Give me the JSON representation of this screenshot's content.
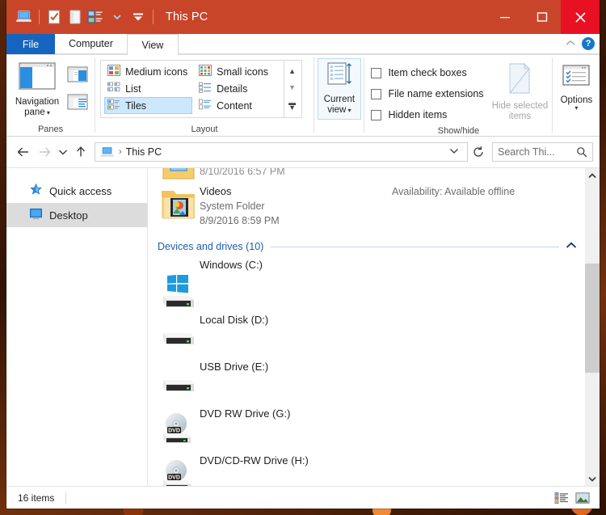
{
  "titlebar": {
    "title": "This PC",
    "quick_access_icons": [
      "this-pc-icon",
      "properties-icon",
      "new-folder-icon",
      "view-icon",
      "customize-dropdown-icon"
    ],
    "window_buttons": [
      {
        "name": "minimize",
        "glyph": "minimize-icon"
      },
      {
        "name": "maximize",
        "glyph": "maximize-icon"
      },
      {
        "name": "close",
        "glyph": "close-icon"
      }
    ],
    "accent_color": "#c9452a",
    "close_color": "#e81123"
  },
  "tabs": {
    "file": "File",
    "items": [
      {
        "label": "Computer",
        "active": false
      },
      {
        "label": "View",
        "active": true
      }
    ],
    "collapse_icon": "chevron-up-icon",
    "help_label": "?"
  },
  "ribbon": {
    "panes": {
      "group_label": "Panes",
      "navigation_pane": "Navigation\npane",
      "navigation_pane_line1": "Navigation",
      "navigation_pane_line2": "pane",
      "preview_pane_icon": "preview-pane-icon",
      "details_pane_icon": "details-pane-icon"
    },
    "layout": {
      "group_label": "Layout",
      "items": [
        {
          "label": "Medium icons",
          "selected": false
        },
        {
          "label": "Small icons",
          "selected": false
        },
        {
          "label": "List",
          "selected": false
        },
        {
          "label": "Details",
          "selected": false
        },
        {
          "label": "Tiles",
          "selected": true
        },
        {
          "label": "Content",
          "selected": false
        }
      ],
      "scroll_up_icon": "scroll-up-icon",
      "scroll_down_icon": "scroll-down-icon",
      "more_icon": "more-layouts-icon"
    },
    "current_view": {
      "group_label": "",
      "line1": "Current",
      "line2": "view",
      "selected": true
    },
    "show_hide": {
      "group_label": "Show/hide",
      "checkboxes": [
        {
          "label": "Item check boxes",
          "checked": false
        },
        {
          "label": "File name extensions",
          "checked": false
        },
        {
          "label": "Hidden items",
          "checked": false
        }
      ],
      "hide_selected_line1": "Hide selected",
      "hide_selected_line2": "items",
      "hide_selected_disabled": true
    },
    "options": {
      "label": "Options"
    }
  },
  "addressbar": {
    "back_icon": "back-arrow-icon",
    "forward_icon": "forward-arrow-icon",
    "recent_icon": "recent-locations-icon",
    "up_icon": "up-arrow-icon",
    "breadcrumb_icon": "this-pc-icon",
    "breadcrumb": "This PC",
    "breadcrumb_separator": "›",
    "dropdown_icon": "chevron-down-icon",
    "refresh_icon": "refresh-icon",
    "search_text": "Search Thi...",
    "search_placeholder": "Search This PC",
    "search_icon": "search-icon"
  },
  "navpane": {
    "items": [
      {
        "label": "Quick access",
        "icon": "star-icon",
        "selected": false
      },
      {
        "label": "Desktop",
        "icon": "desktop-icon",
        "selected": true
      }
    ]
  },
  "filelist": {
    "partial_top_row": {
      "date": "8/10/2016 6:57 PM",
      "icon": "folder-icon"
    },
    "folders": [
      {
        "name": "Videos",
        "type": "System Folder",
        "date": "8/9/2016 8:59 PM",
        "availability": "Availability: Available offline",
        "icon": "videos-folder-icon"
      }
    ],
    "group_header": {
      "label": "Devices and drives (10)",
      "collapse_icon": "chevron-up-icon"
    },
    "drives": [
      {
        "name": "Windows (C:)",
        "icon": "windows-drive-icon"
      },
      {
        "name": "Local Disk (D:)",
        "icon": "hard-drive-icon"
      },
      {
        "name": "USB Drive (E:)",
        "icon": "hard-drive-icon"
      },
      {
        "name": "DVD RW Drive (G:)",
        "icon": "dvd-drive-icon"
      },
      {
        "name": "DVD/CD-RW Drive (H:)",
        "icon": "dvd-drive-icon"
      }
    ],
    "scrollbar": {
      "up_icon": "scroll-up-icon",
      "down_icon": "scroll-down-icon"
    }
  },
  "statusbar": {
    "item_count": "16 items",
    "details_view_icon": "details-view-icon",
    "large_icons_view_icon": "large-icons-view-icon"
  }
}
